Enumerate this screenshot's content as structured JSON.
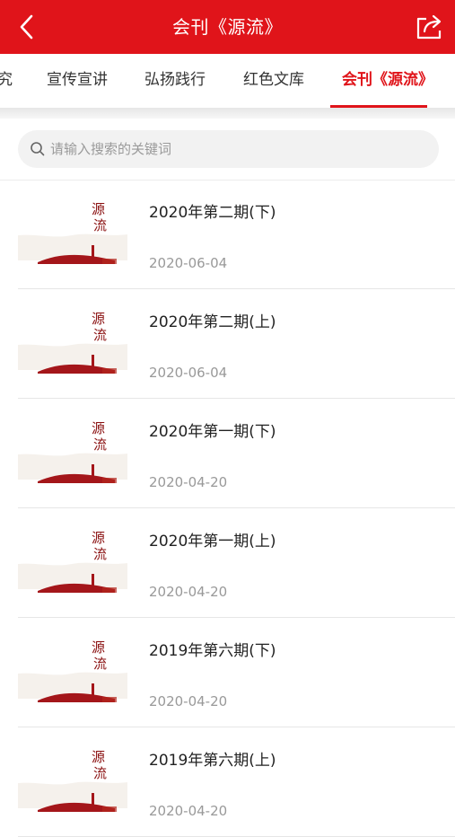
{
  "header": {
    "title": "会刊《源流》",
    "back_icon": "chevron-left-icon",
    "share_icon": "share-icon",
    "background": "#e0141a"
  },
  "tabs": [
    {
      "label": "究",
      "active": false
    },
    {
      "label": "宣传宣讲",
      "active": false
    },
    {
      "label": "弘扬践行",
      "active": false
    },
    {
      "label": "红色文库",
      "active": false
    },
    {
      "label": "会刊《源流》",
      "active": true
    }
  ],
  "search": {
    "placeholder": "请输入搜索的关键词",
    "icon": "search-icon"
  },
  "issues": [
    {
      "title": "2020年第二期(下)",
      "date": "2020-06-04",
      "cover_icon": "yuanliu-cover-thumbnail"
    },
    {
      "title": "2020年第二期(上)",
      "date": "2020-06-04",
      "cover_icon": "yuanliu-cover-thumbnail"
    },
    {
      "title": "2020年第一期(下)",
      "date": "2020-04-20",
      "cover_icon": "yuanliu-cover-thumbnail"
    },
    {
      "title": "2020年第一期(上)",
      "date": "2020-04-20",
      "cover_icon": "yuanliu-cover-thumbnail"
    },
    {
      "title": "2019年第六期(下)",
      "date": "2020-04-20",
      "cover_icon": "yuanliu-cover-thumbnail"
    },
    {
      "title": "2019年第六期(上)",
      "date": "2020-04-20",
      "cover_icon": "yuanliu-cover-thumbnail"
    }
  ],
  "colors": {
    "accent": "#e0141a",
    "cover_red": "#a4161a"
  }
}
